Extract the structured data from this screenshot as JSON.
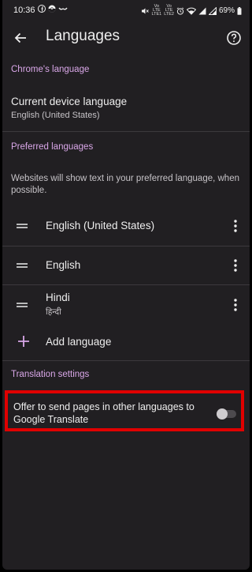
{
  "status_bar": {
    "time": "10:36",
    "battery": "69%",
    "left_icons": [
      "facebook-icon",
      "pokeball-icon",
      "mustache-icon"
    ],
    "right_icons": [
      "mute-icon",
      "volte1-icon",
      "volte2-icon",
      "alarm-icon",
      "wifi-icon",
      "signal-icon",
      "signal-icon",
      "battery-icon"
    ],
    "volte_1": "Vo LTE LTE1",
    "volte_2": "Vo LTE LTE2"
  },
  "app_bar": {
    "title": "Languages",
    "back_icon": "arrow-back-icon",
    "help_icon": "help-circle-icon"
  },
  "chrome_language": {
    "header": "Chrome's language",
    "item_title": "Current device language",
    "item_subtitle": "English (United States)"
  },
  "preferred_languages": {
    "header": "Preferred languages",
    "description": "Websites will show text in your preferred language, when possible.",
    "items": [
      {
        "name": "English (United States)",
        "native": ""
      },
      {
        "name": "English",
        "native": ""
      },
      {
        "name": "Hindi",
        "native": "हिन्दी"
      }
    ],
    "add_label": "Add language"
  },
  "translation_settings": {
    "header": "Translation settings",
    "offer_label": "Offer to send pages in other languages to Google Translate",
    "offer_enabled": false,
    "highlight_color": "#e00000"
  },
  "colors": {
    "background": "#211f22",
    "accent": "#d9a7e8",
    "text_primary": "#eeeeee",
    "text_secondary": "#c6c3c7"
  }
}
